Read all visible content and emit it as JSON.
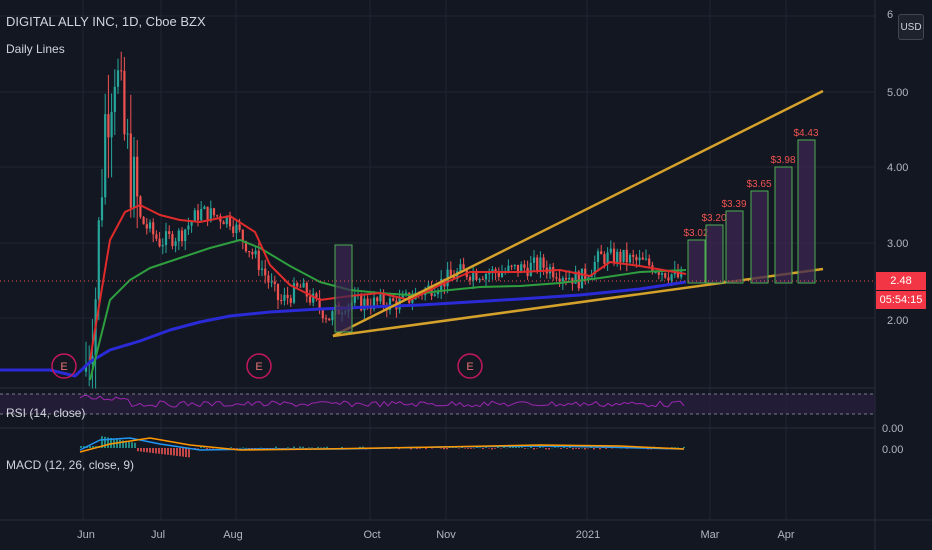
{
  "header": {
    "title": "DIGITAL ALLY INC, 1D, Cboe BZX",
    "indicator": "Daily Lines"
  },
  "currency_button": "USD",
  "rsi_label": "RSI (14, close)",
  "macd_label": "MACD (12, 26, close, 9)",
  "price_axis": {
    "labels": [
      "5.00",
      "4.00",
      "3.00",
      "2.00"
    ],
    "partial_top": "6"
  },
  "rsi_axis_label": "0.00",
  "macd_axis_label": "0.00",
  "current_price": "2.48",
  "countdown": "05:54:15",
  "time_axis": [
    "Jun",
    "Jul",
    "Aug",
    "Oct",
    "Nov",
    "2021",
    "Mar",
    "Apr"
  ],
  "earnings_marker": "E",
  "projection_labels": [
    "$3.02",
    "$3.20",
    "$3.39",
    "$3.65",
    "$3.98",
    "$4.43"
  ],
  "colors": {
    "background": "#131722",
    "up": "#26a69a",
    "down": "#ef5350",
    "trendline": "#d4a12a",
    "ma_red": "#e02b2b",
    "ma_green": "#2e9e3e",
    "ma_blue": "#2a2ad6",
    "rsi": "#9c27b0",
    "macd": "#2196f3",
    "signal": "#ff9800",
    "price_tag": "#f23645"
  },
  "chart_data": {
    "type": "line",
    "ylim": [
      1.0,
      6.0
    ],
    "series": []
  }
}
